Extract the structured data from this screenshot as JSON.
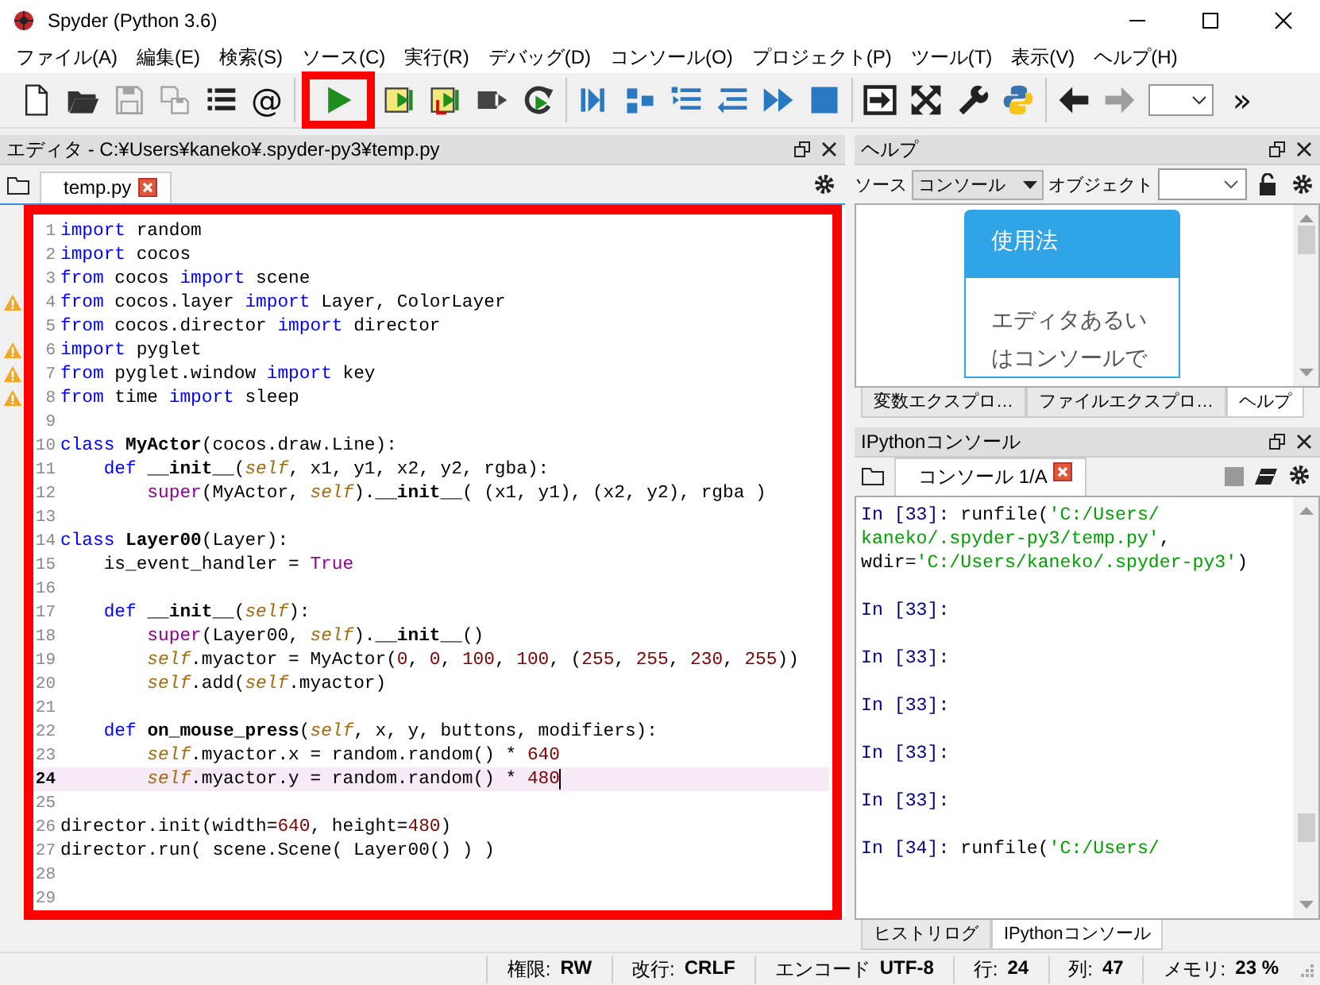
{
  "window": {
    "title": "Spyder (Python 3.6)"
  },
  "menu": [
    "ファイル(A)",
    "編集(E)",
    "検索(S)",
    "ソース(C)",
    "実行(R)",
    "デバッグ(D)",
    "コンソール(O)",
    "プロジェクト(P)",
    "ツール(T)",
    "表示(V)",
    "ヘルプ(H)"
  ],
  "toolbar": {
    "groups": [
      [
        {
          "kind": "new-file",
          "disabled": false,
          "highlighted": false
        },
        {
          "kind": "open",
          "disabled": false,
          "highlighted": false
        },
        {
          "kind": "save",
          "disabled": true,
          "highlighted": false
        },
        {
          "kind": "save-all",
          "disabled": true,
          "highlighted": false
        },
        {
          "kind": "list",
          "disabled": false,
          "highlighted": false
        },
        {
          "kind": "label",
          "label": "@",
          "disabled": false,
          "highlighted": false
        }
      ],
      [
        {
          "kind": "run",
          "disabled": false,
          "highlighted": true
        },
        {
          "kind": "run-cell",
          "disabled": false,
          "highlighted": false
        },
        {
          "kind": "run-cell-advance",
          "disabled": false,
          "highlighted": false
        },
        {
          "kind": "run-selection",
          "disabled": false,
          "highlighted": false
        },
        {
          "kind": "rerun",
          "disabled": false,
          "highlighted": false
        }
      ],
      [
        {
          "kind": "debug",
          "disabled": false,
          "highlighted": false
        },
        {
          "kind": "step",
          "disabled": false,
          "highlighted": false
        },
        {
          "kind": "step-into",
          "disabled": false,
          "highlighted": false
        },
        {
          "kind": "step-return",
          "disabled": false,
          "highlighted": false
        },
        {
          "kind": "continue",
          "disabled": false,
          "highlighted": false
        },
        {
          "kind": "stop",
          "disabled": false,
          "highlighted": false
        }
      ],
      [
        {
          "kind": "maximize",
          "disabled": false,
          "highlighted": false
        },
        {
          "kind": "fullscreen",
          "disabled": false,
          "highlighted": false
        },
        {
          "kind": "wrench",
          "disabled": false,
          "highlighted": false
        },
        {
          "kind": "python",
          "disabled": false,
          "highlighted": false
        }
      ],
      [
        {
          "kind": "back",
          "disabled": false,
          "highlighted": false
        },
        {
          "kind": "forward",
          "disabled": true,
          "highlighted": false
        },
        {
          "kind": "combo",
          "disabled": false,
          "highlighted": false
        },
        {
          "kind": "label",
          "label": "»",
          "disabled": false,
          "highlighted": false
        }
      ]
    ]
  },
  "editor": {
    "title": "エディタ - C:¥Users¥kaneko¥.spyder-py3¥temp.py",
    "tabs": [
      {
        "label": "temp.py",
        "selected": true
      }
    ],
    "highlighted": true,
    "lines": [
      {
        "number": "1",
        "warning": false,
        "current": false,
        "tokens": [
          {
            "kind": "keyword",
            "text": "import"
          },
          {
            "kind": "text",
            "text": " random"
          }
        ]
      },
      {
        "number": "2",
        "warning": false,
        "current": false,
        "tokens": [
          {
            "kind": "keyword",
            "text": "import"
          },
          {
            "kind": "text",
            "text": " cocos"
          }
        ]
      },
      {
        "number": "3",
        "warning": false,
        "current": false,
        "tokens": [
          {
            "kind": "keyword",
            "text": "from"
          },
          {
            "kind": "text",
            "text": " cocos "
          },
          {
            "kind": "keyword",
            "text": "import"
          },
          {
            "kind": "text",
            "text": " scene"
          }
        ]
      },
      {
        "number": "4",
        "warning": true,
        "current": false,
        "tokens": [
          {
            "kind": "keyword",
            "text": "from"
          },
          {
            "kind": "text",
            "text": " cocos.layer "
          },
          {
            "kind": "keyword",
            "text": "import"
          },
          {
            "kind": "text",
            "text": " Layer, ColorLayer"
          }
        ]
      },
      {
        "number": "5",
        "warning": false,
        "current": false,
        "tokens": [
          {
            "kind": "keyword",
            "text": "from"
          },
          {
            "kind": "text",
            "text": " cocos.director "
          },
          {
            "kind": "keyword",
            "text": "import"
          },
          {
            "kind": "text",
            "text": " director"
          }
        ]
      },
      {
        "number": "6",
        "warning": true,
        "current": false,
        "tokens": [
          {
            "kind": "keyword",
            "text": "import"
          },
          {
            "kind": "text",
            "text": " pyglet"
          }
        ]
      },
      {
        "number": "7",
        "warning": true,
        "current": false,
        "tokens": [
          {
            "kind": "keyword",
            "text": "from"
          },
          {
            "kind": "text",
            "text": " pyglet.window "
          },
          {
            "kind": "keyword",
            "text": "import"
          },
          {
            "kind": "text",
            "text": " key"
          }
        ]
      },
      {
        "number": "8",
        "warning": true,
        "current": false,
        "tokens": [
          {
            "kind": "keyword",
            "text": "from"
          },
          {
            "kind": "text",
            "text": " time "
          },
          {
            "kind": "keyword",
            "text": "import"
          },
          {
            "kind": "text",
            "text": " sleep"
          }
        ]
      },
      {
        "number": "9",
        "warning": false,
        "current": false
      },
      {
        "number": "10",
        "warning": false,
        "current": false,
        "tokens": [
          {
            "kind": "keyword",
            "text": "class "
          },
          {
            "kind": "defname",
            "text": "MyActor"
          },
          {
            "kind": "text",
            "text": "(cocos.draw.Line):"
          }
        ]
      },
      {
        "number": "11",
        "warning": false,
        "current": false,
        "tokens": [
          {
            "kind": "keyword",
            "text": "    def "
          },
          {
            "kind": "defname",
            "text": "__init__"
          },
          {
            "kind": "text",
            "text": "("
          },
          {
            "kind": "self",
            "text": "self"
          },
          {
            "kind": "text",
            "text": ", x1, y1, x2, y2, rgba):"
          }
        ]
      },
      {
        "number": "12",
        "warning": false,
        "current": false,
        "tokens": [
          {
            "kind": "builtin",
            "text": "        super"
          },
          {
            "kind": "text",
            "text": "(MyActor, "
          },
          {
            "kind": "self",
            "text": "self"
          },
          {
            "kind": "text",
            "text": ")."
          },
          {
            "kind": "defname",
            "text": "__init__"
          },
          {
            "kind": "text",
            "text": "( (x1, y1), (x2, y2), rgba )"
          }
        ]
      },
      {
        "number": "13",
        "warning": false,
        "current": false
      },
      {
        "number": "14",
        "warning": false,
        "current": false,
        "tokens": [
          {
            "kind": "keyword",
            "text": "class "
          },
          {
            "kind": "defname",
            "text": "Layer00"
          },
          {
            "kind": "text",
            "text": "(Layer):"
          }
        ]
      },
      {
        "number": "15",
        "warning": false,
        "current": false,
        "tokens": [
          {
            "kind": "text",
            "text": "    is_event_handler = "
          },
          {
            "kind": "builtin",
            "text": "True"
          }
        ]
      },
      {
        "number": "16",
        "warning": false,
        "current": false
      },
      {
        "number": "17",
        "warning": false,
        "current": false,
        "tokens": [
          {
            "kind": "keyword",
            "text": "    def "
          },
          {
            "kind": "defname",
            "text": "__init__"
          },
          {
            "kind": "text",
            "text": "("
          },
          {
            "kind": "self",
            "text": "self"
          },
          {
            "kind": "text",
            "text": "):"
          }
        ]
      },
      {
        "number": "18",
        "warning": false,
        "current": false,
        "tokens": [
          {
            "kind": "builtin",
            "text": "        super"
          },
          {
            "kind": "text",
            "text": "(Layer00, "
          },
          {
            "kind": "self",
            "text": "self"
          },
          {
            "kind": "text",
            "text": ")."
          },
          {
            "kind": "defname",
            "text": "__init__"
          },
          {
            "kind": "text",
            "text": "()"
          }
        ]
      },
      {
        "number": "19",
        "warning": false,
        "current": false,
        "tokens": [
          {
            "kind": "self",
            "text": "        self"
          },
          {
            "kind": "text",
            "text": ".myactor = MyActor("
          },
          {
            "kind": "number",
            "text": "0"
          },
          {
            "kind": "text",
            "text": ", "
          },
          {
            "kind": "number",
            "text": "0"
          },
          {
            "kind": "text",
            "text": ", "
          },
          {
            "kind": "number",
            "text": "100"
          },
          {
            "kind": "text",
            "text": ", "
          },
          {
            "kind": "number",
            "text": "100"
          },
          {
            "kind": "text",
            "text": ", ("
          },
          {
            "kind": "number",
            "text": "255"
          },
          {
            "kind": "text",
            "text": ", "
          },
          {
            "kind": "number",
            "text": "255"
          },
          {
            "kind": "text",
            "text": ", "
          },
          {
            "kind": "number",
            "text": "230"
          },
          {
            "kind": "text",
            "text": ", "
          },
          {
            "kind": "number",
            "text": "255"
          },
          {
            "kind": "text",
            "text": "))"
          }
        ]
      },
      {
        "number": "20",
        "warning": false,
        "current": false,
        "tokens": [
          {
            "kind": "self",
            "text": "        self"
          },
          {
            "kind": "text",
            "text": ".add("
          },
          {
            "kind": "self",
            "text": "self"
          },
          {
            "kind": "text",
            "text": ".myactor)"
          }
        ]
      },
      {
        "number": "21",
        "warning": false,
        "current": false
      },
      {
        "number": "22",
        "warning": false,
        "current": false,
        "tokens": [
          {
            "kind": "keyword",
            "text": "    def "
          },
          {
            "kind": "defname",
            "text": "on_mouse_press"
          },
          {
            "kind": "text",
            "text": "("
          },
          {
            "kind": "self",
            "text": "self"
          },
          {
            "kind": "text",
            "text": ", x, y, buttons, modifiers):"
          }
        ]
      },
      {
        "number": "23",
        "warning": false,
        "current": false,
        "tokens": [
          {
            "kind": "self",
            "text": "        self"
          },
          {
            "kind": "text",
            "text": ".myactor.x = random.random() * "
          },
          {
            "kind": "number",
            "text": "640"
          }
        ]
      },
      {
        "number": "24",
        "warning": false,
        "current": true,
        "tokens": [
          {
            "kind": "self",
            "text": "        self"
          },
          {
            "kind": "text",
            "text": ".myactor.y = random.random() * "
          },
          {
            "kind": "number",
            "text": "480"
          }
        ]
      },
      {
        "number": "25",
        "warning": false,
        "current": false
      },
      {
        "number": "26",
        "warning": false,
        "current": false,
        "tokens": [
          {
            "kind": "text",
            "text": "director.init(width="
          },
          {
            "kind": "number",
            "text": "640"
          },
          {
            "kind": "text",
            "text": ", height="
          },
          {
            "kind": "number",
            "text": "480"
          },
          {
            "kind": "text",
            "text": ")"
          }
        ]
      },
      {
        "number": "27",
        "warning": false,
        "current": false,
        "tokens": [
          {
            "kind": "text",
            "text": "director.run( scene.Scene( Layer00() ) )"
          }
        ]
      },
      {
        "number": "28",
        "warning": false,
        "current": false
      },
      {
        "number": "29",
        "warning": false,
        "current": false
      }
    ]
  },
  "help": {
    "title": "ヘルプ",
    "source_label": "ソース",
    "source": "コンソール",
    "object_label": "オブジェクト",
    "card_title": "使用法",
    "card_text": "エディタあるいはコンソールで",
    "tabs": [
      {
        "label": "変数エクスプロ…",
        "selected": false
      },
      {
        "label": "ファイルエクスプロ…",
        "selected": false
      },
      {
        "label": "ヘルプ",
        "selected": true
      }
    ]
  },
  "console": {
    "title": "IPythonコンソール",
    "tabs": [
      {
        "label": "コンソール 1/A",
        "selected": true
      }
    ],
    "entries": [
      [
        [
          {
            "kind": "prompt",
            "text": "In [33]:"
          },
          {
            "kind": "text",
            "text": " runfile("
          },
          {
            "kind": "string",
            "text": "'C:/Users/"
          }
        ],
        [
          {
            "kind": "string",
            "text": "kaneko/.spyder-py3/temp.py'"
          },
          {
            "kind": "text",
            "text": ","
          }
        ],
        [
          {
            "kind": "text",
            "text": "wdir="
          },
          {
            "kind": "string",
            "text": "'C:/Users/kaneko/.spyder-py3'"
          },
          {
            "kind": "text",
            "text": ")"
          }
        ]
      ],
      [
        [
          {
            "kind": "prompt",
            "text": "In [33]:"
          }
        ]
      ],
      [
        [
          {
            "kind": "prompt",
            "text": "In [33]:"
          }
        ]
      ],
      [
        [
          {
            "kind": "prompt",
            "text": "In [33]:"
          }
        ]
      ],
      [
        [
          {
            "kind": "prompt",
            "text": "In [33]:"
          }
        ]
      ],
      [
        [
          {
            "kind": "prompt",
            "text": "In [33]:"
          }
        ]
      ],
      [
        [
          {
            "kind": "prompt",
            "text": "In [34]:"
          },
          {
            "kind": "text",
            "text": " runfile("
          },
          {
            "kind": "string",
            "text": "'C:/Users/"
          }
        ]
      ]
    ],
    "bottom_tabs": [
      {
        "label": "ヒストリログ",
        "selected": false
      },
      {
        "label": "IPythonコンソール",
        "selected": true
      }
    ]
  },
  "status_bar": [
    {
      "label": "権限:",
      "value": "RW"
    },
    {
      "label": "改行:",
      "value": "CRLF"
    },
    {
      "label": "エンコード",
      "value": "UTF-8"
    },
    {
      "label": "行:",
      "value": "24"
    },
    {
      "label": "列:",
      "value": "47"
    },
    {
      "label": "メモリ:",
      "value": "23 %"
    }
  ]
}
